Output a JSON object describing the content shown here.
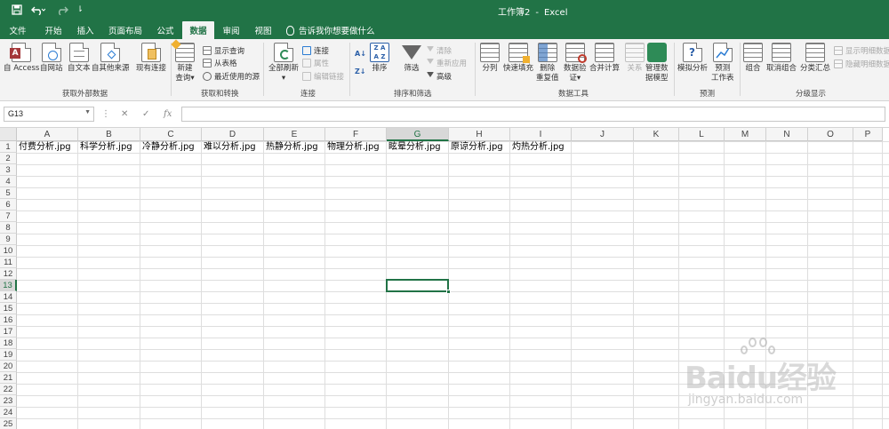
{
  "window": {
    "title": "工作簿2",
    "app": "Excel",
    "separator": "-",
    "title_bar_color": "#217346"
  },
  "quick_access": [
    {
      "name": "save-icon",
      "glyph": "🖫"
    },
    {
      "name": "undo-icon",
      "glyph": "↶"
    },
    {
      "name": "redo-icon",
      "glyph": "↷"
    },
    {
      "name": "customize-icon",
      "glyph": "⇂"
    }
  ],
  "tabs": [
    {
      "label": "文件"
    },
    {
      "label": "开始"
    },
    {
      "label": "插入"
    },
    {
      "label": "页面布局"
    },
    {
      "label": "公式"
    },
    {
      "label": "数据",
      "active": true
    },
    {
      "label": "审阅"
    },
    {
      "label": "视图"
    }
  ],
  "tell_me": "告诉我你想要做什么",
  "ribbon": {
    "groups": {
      "external": "获取外部数据",
      "transform": "获取和转换",
      "connections": "连接",
      "sort_filter": "排序和筛选",
      "data_tools": "数据工具",
      "forecast": "预测",
      "outline": "分级显示"
    },
    "buttons": {
      "from_access": "自 Access",
      "from_web": "自网站",
      "from_text": "自文本",
      "from_other": "自其他来源",
      "existing": "现有连接",
      "new_query_1": "新建",
      "new_query_2": "查询▾",
      "show_queries": "显示查询",
      "from_table": "从表格",
      "recent_sources": "最近使用的源",
      "refresh_all_1": "全部刷新",
      "refresh_all_2": "▾",
      "connections": "连接",
      "properties": "属性",
      "edit_links": "编辑链接",
      "sort": "排序",
      "filter": "筛选",
      "clear": "清除",
      "reapply": "重新应用",
      "advanced": "高级",
      "text_to_columns": "分列",
      "flash_fill": "快速填充",
      "remove_dup_1": "删除",
      "remove_dup_2": "重复值",
      "validation_1": "数据验",
      "validation_2": "证▾",
      "consolidate": "合并计算",
      "relationships": "关系",
      "data_model_1": "管理数",
      "data_model_2": "据模型",
      "what_if": "模拟分析",
      "forecast_1": "预测",
      "forecast_2": "工作表",
      "group": "组合",
      "ungroup": "取消组合",
      "subtotal": "分类汇总",
      "show_detail": "显示明细数据",
      "hide_detail": "隐藏明细数据"
    }
  },
  "formula_bar": {
    "name_box": "G13",
    "fx": "fx",
    "cancel": "✕",
    "enter": "✓",
    "formula": ""
  },
  "grid": {
    "columns": [
      "A",
      "B",
      "C",
      "D",
      "E",
      "F",
      "G",
      "H",
      "I",
      "J",
      "K",
      "L",
      "M",
      "N",
      "O",
      "P"
    ],
    "rows": [
      "1",
      "2",
      "3",
      "4",
      "5",
      "6",
      "7",
      "8",
      "9",
      "10",
      "11",
      "12",
      "13",
      "14",
      "15",
      "16",
      "17",
      "18",
      "19",
      "20",
      "21",
      "22",
      "23",
      "24",
      "25"
    ],
    "selected_cell": "G13",
    "row1": [
      "付费分析.jpg",
      "科学分析.jpg",
      "冷静分析.jpg",
      "难以分析.jpg",
      "热静分析.jpg",
      "物理分析.jpg",
      "眩晕分析.jpg",
      "原谅分析.jpg",
      "灼热分析.jpg"
    ]
  },
  "watermark": {
    "logo": "Baidu经验",
    "url": "jingyan.baidu.com"
  }
}
